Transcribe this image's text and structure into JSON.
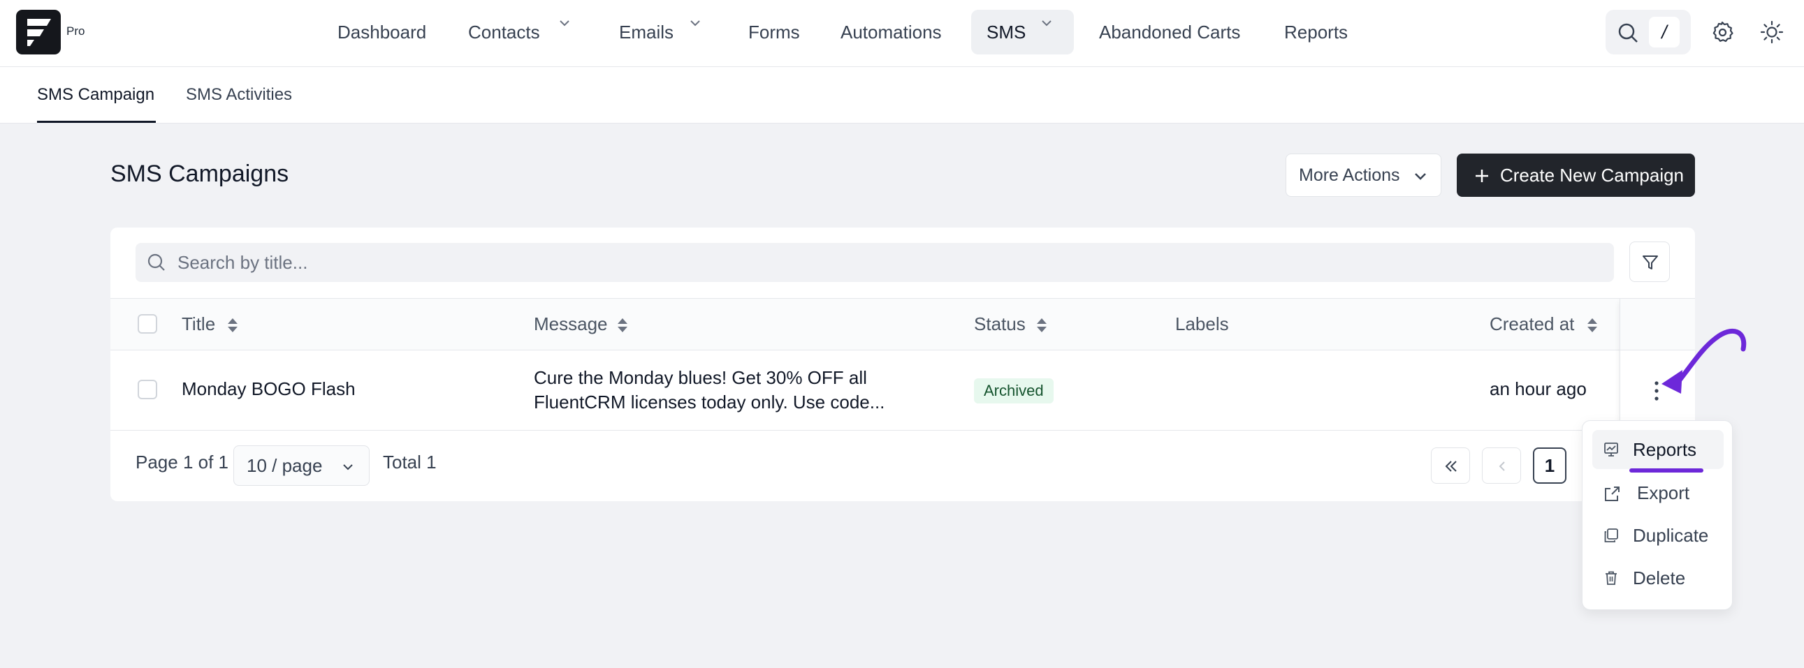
{
  "brand": {
    "badge": "Pro",
    "accent": "#6d28d9"
  },
  "nav": {
    "items": [
      {
        "label": "Dashboard"
      },
      {
        "label": "Contacts"
      },
      {
        "label": "Emails"
      },
      {
        "label": "Forms"
      },
      {
        "label": "Automations"
      },
      {
        "label": "SMS"
      },
      {
        "label": "Abandoned Carts"
      },
      {
        "label": "Reports"
      }
    ],
    "search_shortcut": "/"
  },
  "subtabs": [
    {
      "label": "SMS Campaign"
    },
    {
      "label": "SMS Activities"
    }
  ],
  "page": {
    "title": "SMS Campaigns",
    "more_actions": "More Actions",
    "create_button": "Create New Campaign"
  },
  "search": {
    "placeholder": "Search by title..."
  },
  "table": {
    "columns": [
      "Title",
      "Message",
      "Status",
      "Labels",
      "Created at"
    ],
    "rows": [
      {
        "title": "Monday BOGO Flash",
        "message_line1": "Cure the Monday blues! Get 30% OFF all",
        "message_line2": "FluentCRM licenses today only. Use code...",
        "status": "Archived",
        "labels": "",
        "created_at": "an hour ago"
      }
    ]
  },
  "pagination": {
    "page_info": "Page 1 of 1",
    "per_page": "10 / page",
    "total": "Total 1",
    "current_page": "1"
  },
  "row_menu": {
    "items": [
      {
        "label": "Reports",
        "icon": "chart-board-icon"
      },
      {
        "label": "Export",
        "icon": "export-icon"
      },
      {
        "label": "Duplicate",
        "icon": "copy-icon"
      },
      {
        "label": "Delete",
        "icon": "trash-icon"
      }
    ]
  }
}
